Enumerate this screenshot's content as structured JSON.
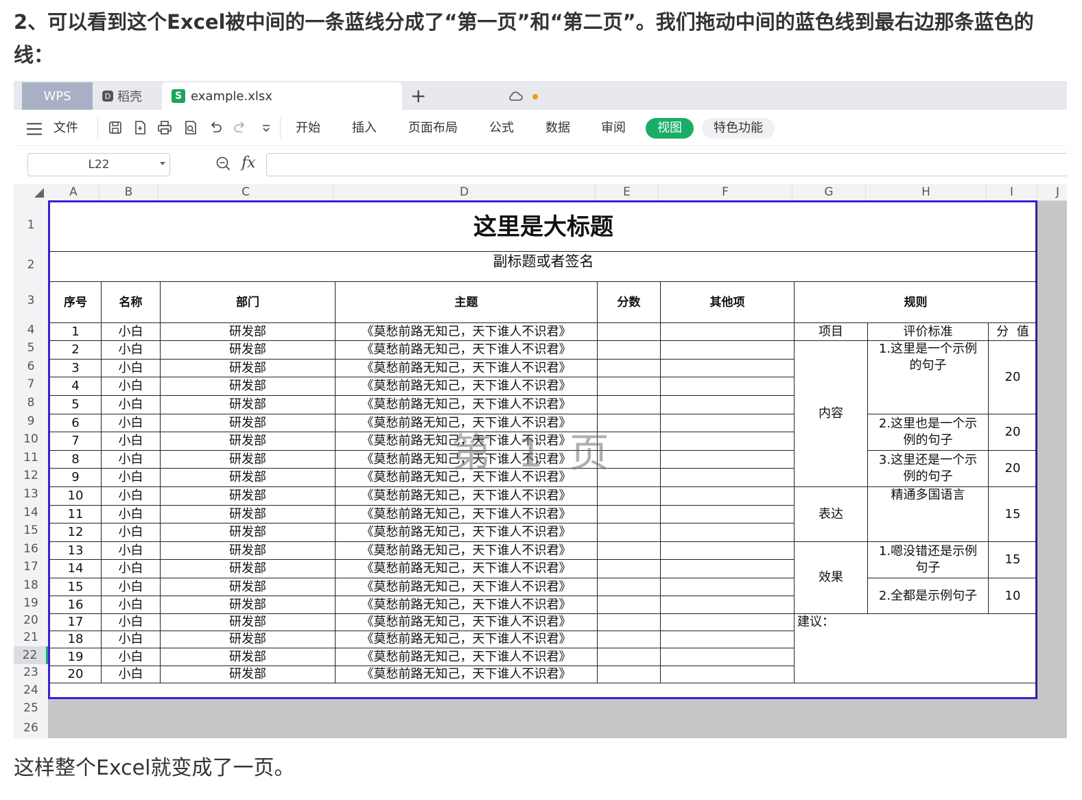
{
  "article": {
    "heading": "2、可以看到这个Excel被中间的一条蓝线分成了“第一页”和“第二页”。我们拖动中间的蓝色线到最右边那条蓝色的线：",
    "footer": "这样整个Excel就变成了一页。"
  },
  "app": {
    "tabs": {
      "wps": "WPS",
      "daoke": "稻壳",
      "file": "example.xlsx",
      "s_glyph": "S",
      "d_glyph": "D",
      "plus": "+"
    },
    "menu": {
      "file": "文件",
      "start": "开始",
      "insert": "插入",
      "page_layout": "页面布局",
      "formula": "公式",
      "data": "数据",
      "review": "审阅",
      "view": "视图",
      "special": "特色功能"
    },
    "formula_bar": {
      "cell_ref": "L22",
      "fx": "fx",
      "value": ""
    },
    "accent": "#1aad68",
    "page_border_color": "#3a1fd0",
    "unsaved_dot_color": "#f0a000"
  },
  "sheet": {
    "columns": [
      "A",
      "B",
      "C",
      "D",
      "E",
      "F",
      "G",
      "H",
      "I",
      "J"
    ],
    "rows": [
      "1",
      "2",
      "3",
      "4",
      "5",
      "6",
      "7",
      "8",
      "9",
      "10",
      "11",
      "12",
      "13",
      "14",
      "15",
      "16",
      "17",
      "18",
      "19",
      "20",
      "21",
      "22",
      "23",
      "24",
      "25",
      "26"
    ],
    "selected_row": "22",
    "title": "这里是大标题",
    "subtitle": "副标题或者签名",
    "headers": {
      "seq": "序号",
      "name": "名称",
      "dept": "部门",
      "topic": "主题",
      "score": "分数",
      "other": "其他项",
      "rules": "规则"
    },
    "data_rows": [
      {
        "seq": "1",
        "name": "小白",
        "dept": "研发部",
        "topic": "《莫愁前路无知己，天下谁人不识君》"
      },
      {
        "seq": "2",
        "name": "小白",
        "dept": "研发部",
        "topic": "《莫愁前路无知己，天下谁人不识君》"
      },
      {
        "seq": "3",
        "name": "小白",
        "dept": "研发部",
        "topic": "《莫愁前路无知己，天下谁人不识君》"
      },
      {
        "seq": "4",
        "name": "小白",
        "dept": "研发部",
        "topic": "《莫愁前路无知己，天下谁人不识君》"
      },
      {
        "seq": "5",
        "name": "小白",
        "dept": "研发部",
        "topic": "《莫愁前路无知己，天下谁人不识君》"
      },
      {
        "seq": "6",
        "name": "小白",
        "dept": "研发部",
        "topic": "《莫愁前路无知己，天下谁人不识君》"
      },
      {
        "seq": "7",
        "name": "小白",
        "dept": "研发部",
        "topic": "《莫愁前路无知己，天下谁人不识君》"
      },
      {
        "seq": "8",
        "name": "小白",
        "dept": "研发部",
        "topic": "《莫愁前路无知己，天下谁人不识君》"
      },
      {
        "seq": "9",
        "name": "小白",
        "dept": "研发部",
        "topic": "《莫愁前路无知己，天下谁人不识君》"
      },
      {
        "seq": "10",
        "name": "小白",
        "dept": "研发部",
        "topic": "《莫愁前路无知己，天下谁人不识君》"
      },
      {
        "seq": "11",
        "name": "小白",
        "dept": "研发部",
        "topic": "《莫愁前路无知己，天下谁人不识君》"
      },
      {
        "seq": "12",
        "name": "小白",
        "dept": "研发部",
        "topic": "《莫愁前路无知己，天下谁人不识君》"
      },
      {
        "seq": "13",
        "name": "小白",
        "dept": "研发部",
        "topic": "《莫愁前路无知己，天下谁人不识君》"
      },
      {
        "seq": "14",
        "name": "小白",
        "dept": "研发部",
        "topic": "《莫愁前路无知己，天下谁人不识君》"
      },
      {
        "seq": "15",
        "name": "小白",
        "dept": "研发部",
        "topic": "《莫愁前路无知己，天下谁人不识君》"
      },
      {
        "seq": "16",
        "name": "小白",
        "dept": "研发部",
        "topic": "《莫愁前路无知己，天下谁人不识君》"
      },
      {
        "seq": "17",
        "name": "小白",
        "dept": "研发部",
        "topic": "《莫愁前路无知己，天下谁人不识君》"
      },
      {
        "seq": "18",
        "name": "小白",
        "dept": "研发部",
        "topic": "《莫愁前路无知己，天下谁人不识君》"
      },
      {
        "seq": "19",
        "name": "小白",
        "dept": "研发部",
        "topic": "《莫愁前路无知己，天下谁人不识君》"
      },
      {
        "seq": "20",
        "name": "小白",
        "dept": "研发部",
        "topic": "《莫愁前路无知己，天下谁人不识君》"
      }
    ],
    "rules": {
      "col_item": "项目",
      "col_criteria": "评价标准",
      "col_value": "分  值",
      "content": "内容",
      "express": "表达",
      "effect": "效果",
      "c1": "1.这里是一个示例的句子",
      "v1": "20",
      "c2": "2.这里也是一个示例的句子",
      "v2": "20",
      "c3": "3.这里还是一个示例的句子",
      "v3": "20",
      "e1": "精通多国语言",
      "v4": "15",
      "f1": "1.嗯没错还是示例句子",
      "v5": "15",
      "f2": "2.全都是示例句子",
      "v6": "10",
      "suggest": "建议："
    },
    "watermark": "第 1 页"
  }
}
